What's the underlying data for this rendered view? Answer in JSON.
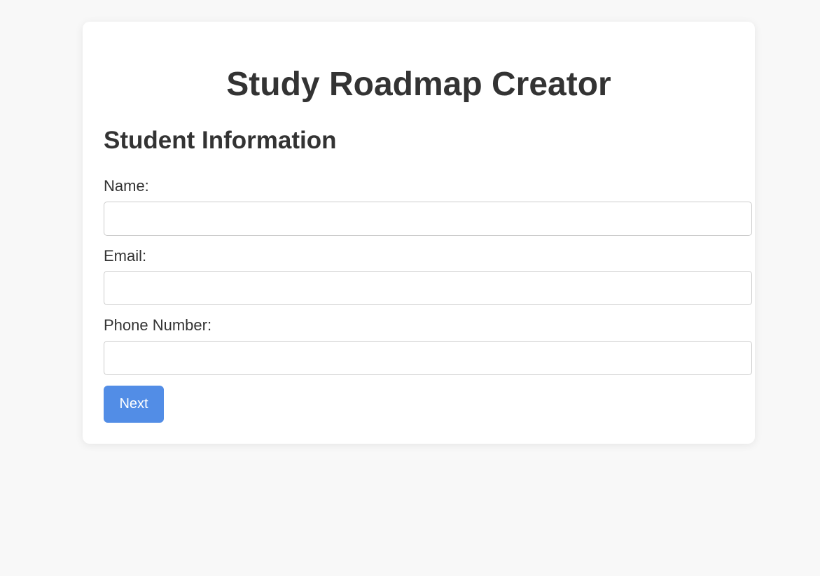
{
  "app": {
    "title": "Study Roadmap Creator"
  },
  "form": {
    "section_title": "Student Information",
    "fields": [
      {
        "label": "Name:",
        "value": "",
        "placeholder": ""
      },
      {
        "label": "Email:",
        "value": "",
        "placeholder": ""
      },
      {
        "label": "Phone Number:",
        "value": "",
        "placeholder": ""
      }
    ],
    "next_label": "Next"
  },
  "colors": {
    "background": "#f8f8f8",
    "card": "#ffffff",
    "text": "#333333",
    "accent": "#528de6",
    "input_border": "#cccccc"
  }
}
